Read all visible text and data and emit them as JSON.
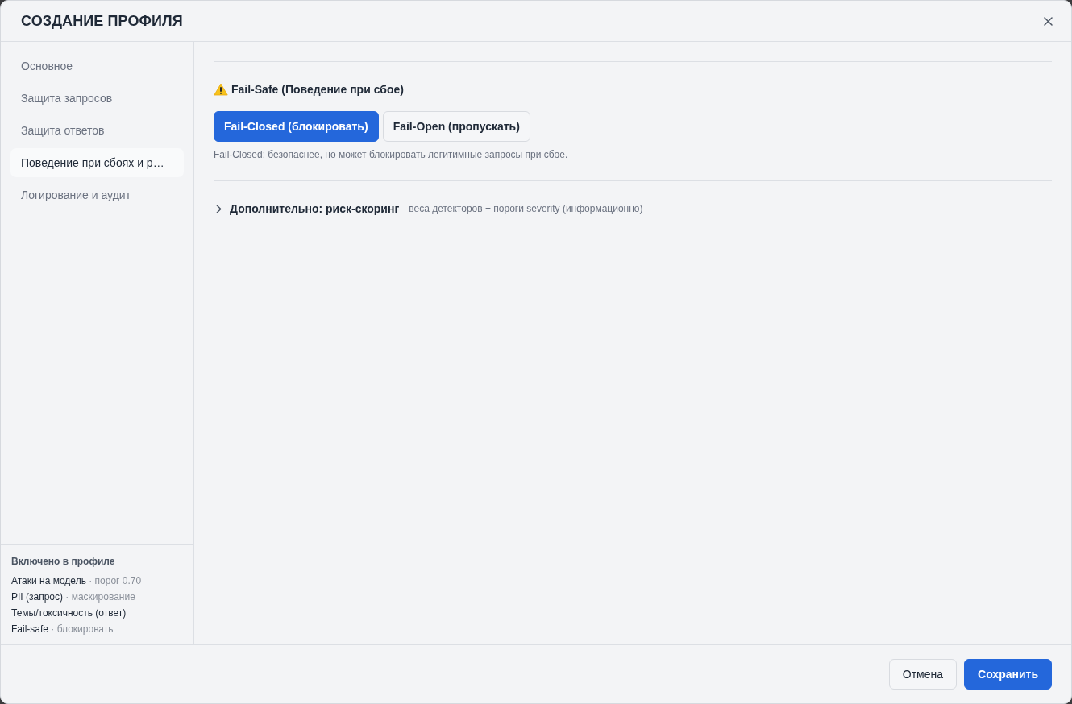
{
  "dialog": {
    "title": "СОЗДАНИЕ ПРОФИЛЯ"
  },
  "sidebar": {
    "items": [
      {
        "label": "Основное",
        "selected": false
      },
      {
        "label": "Защита запросов",
        "selected": false
      },
      {
        "label": "Защита ответов",
        "selected": false
      },
      {
        "label": "Поведение при сбоях и р…",
        "selected": true
      },
      {
        "label": "Логирование и аудит",
        "selected": false
      }
    ],
    "summary": {
      "title": "Включено в профиле",
      "items": [
        {
          "name": "Атаки на модель",
          "detail": "· порог 0.70"
        },
        {
          "name": "PII (запрос)",
          "detail": "· маскирование"
        },
        {
          "name": "Темы/токсичность (ответ)"
        },
        {
          "name": "Fail-safe",
          "detail": "· блокировать"
        }
      ]
    }
  },
  "fail_safe": {
    "title": "Fail-Safe (Поведение при сбое)",
    "options": [
      {
        "label": "Fail-Closed (блокировать)",
        "selected": true
      },
      {
        "label": "Fail-Open (пропускать)",
        "selected": false
      }
    ],
    "hint": "Fail-Closed: безопаснее, но может блокировать легитимные запросы при сбое."
  },
  "advanced": {
    "title": "Дополнительно: риск-скоринг",
    "subtitle": "веса детекторов + пороги severity (информационно)",
    "expanded": false
  },
  "footer": {
    "buttons": [
      {
        "label": "Отмена",
        "kind": "secondary"
      },
      {
        "label": "Сохранить",
        "kind": "primary"
      }
    ]
  }
}
